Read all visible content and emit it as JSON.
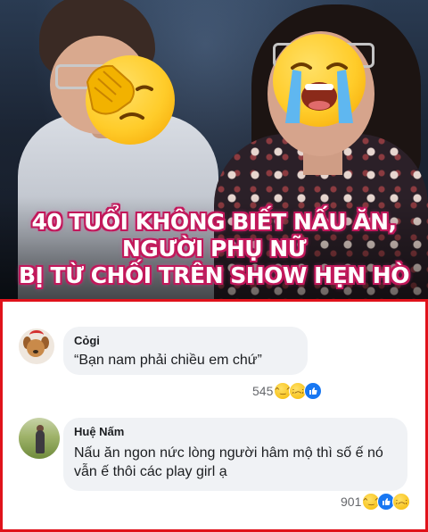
{
  "headline": {
    "line1": "40 TUỔI KHÔNG BIẾT NẤU ĂN,",
    "line2": "NGƯỜI PHỤ NỮ",
    "line3": "BỊ TỪ CHỐI TRÊN SHOW HẸN HÒ"
  },
  "emojis": {
    "left": "face-palm-emoji",
    "right": "loudly-crying-emoji"
  },
  "comments": [
    {
      "author": "Cỏgi",
      "text": "“Bạn nam phải chiều em chứ”",
      "reaction_count": "545",
      "reactions": [
        "haha",
        "sad",
        "like"
      ]
    },
    {
      "author": "Huệ Nấm",
      "text": "Nấu ăn ngon nức lòng người hâm mộ thì số ế nó vẫn ế thôi các play girl ạ",
      "reaction_count": "901",
      "reactions": [
        "haha",
        "like",
        "sad"
      ]
    }
  ],
  "colors": {
    "frame_border": "#e0121b",
    "headline_outline": "#c2185b",
    "like_blue": "#1877f2",
    "bubble_bg": "#f0f2f5"
  }
}
